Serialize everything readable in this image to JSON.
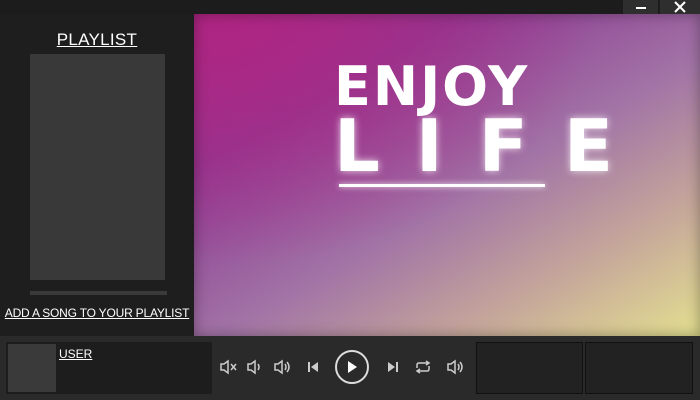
{
  "window": {
    "controls": [
      "minimize-icon",
      "close-icon"
    ]
  },
  "sidebar": {
    "title": "PLAYLIST",
    "add_song_label": "ADD A SONG TO YOUR PLAYLIST"
  },
  "artwork": {
    "line1": "ENJOY",
    "line2": "LIFE"
  },
  "user": {
    "label": "USER"
  },
  "controls": {
    "icons": [
      "mute-icon",
      "volume-low-icon",
      "volume-mid-icon",
      "previous-icon",
      "play-icon",
      "next-icon",
      "repeat-icon",
      "volume-high-icon"
    ]
  },
  "colors": {
    "art_top_left": "#b0247f",
    "art_bottom_right": "#e4e090",
    "panel": "#1e1e1e"
  }
}
